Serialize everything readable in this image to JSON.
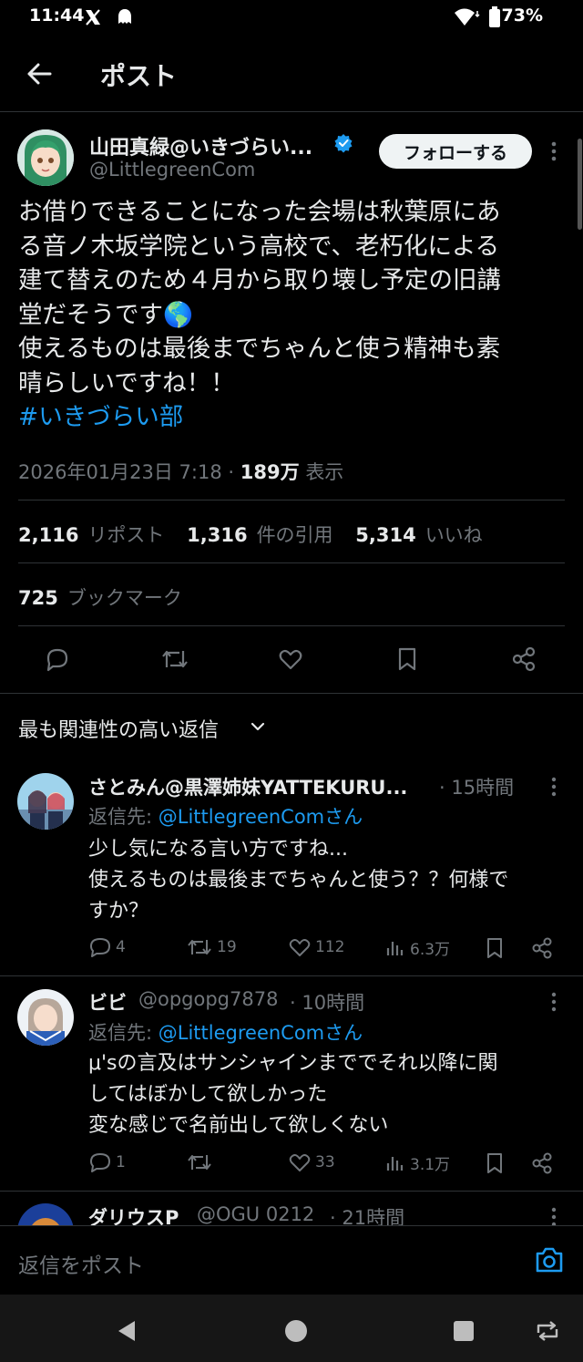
{
  "status_bar": {
    "time": "11:44",
    "battery": "73%"
  },
  "header": {
    "title": "ポスト"
  },
  "tweet": {
    "author_name": "山田真緑@いきづらい...",
    "author_handle": "@LittlegreenCom",
    "follow_label": "フォローする",
    "lines": [
      "お借りできることになった会場は秋葉原にあ",
      "る音ノ木坂学院という高校で、老朽化による",
      "建て替えのため４月から取り壊し予定の旧講",
      "堂だそうです🌎",
      "使えるものは最後までちゃんと使う精神も素",
      "晴らしいですね！！"
    ],
    "hashtag": "#いきづらい部",
    "datetime": "2026年01月23日 7:18",
    "views_count": "189万",
    "views_label": "表示",
    "reposts_count": "2,116",
    "reposts_label": "リポスト",
    "quotes_count": "1,316",
    "quotes_label": "件の引用",
    "likes_count": "5,314",
    "likes_label": "いいね",
    "bookmarks_count": "725",
    "bookmarks_label": "ブックマーク"
  },
  "replies_section": {
    "label": "最も関連性の高い返信"
  },
  "replies": [
    {
      "name": "さとみん@黒澤姉妹YATTEKURU...",
      "time": "· 15時間",
      "reply_to_prefix": "返信先:",
      "reply_to": "@LittlegreenComさん",
      "lines": [
        "少し気になる言い方ですね...",
        "使えるものは最後までちゃんと使う？？何様で",
        "すか？"
      ],
      "comments": "4",
      "reposts": "19",
      "likes": "112",
      "views": "6.3万"
    },
    {
      "name": "ビビ",
      "handle": "@opgopg7878",
      "time": "· 10時間",
      "reply_to_prefix": "返信先:",
      "reply_to": "@LittlegreenComさん",
      "lines": [
        "μ'sの言及はサンシャインまででそれ以降に関",
        "してはぼかして欲しかった",
        "変な感じで名前出して欲しくない"
      ],
      "comments": "1",
      "reposts": "",
      "likes": "33",
      "views": "3.1万"
    },
    {
      "name": "ダリウスP",
      "handle": "@OGU 0212",
      "time": "· 21時間"
    }
  ],
  "compose": {
    "placeholder": "返信をポスト"
  },
  "colors": {
    "accent": "#1d9bf0",
    "background": "#000000",
    "muted": "#71767b"
  }
}
